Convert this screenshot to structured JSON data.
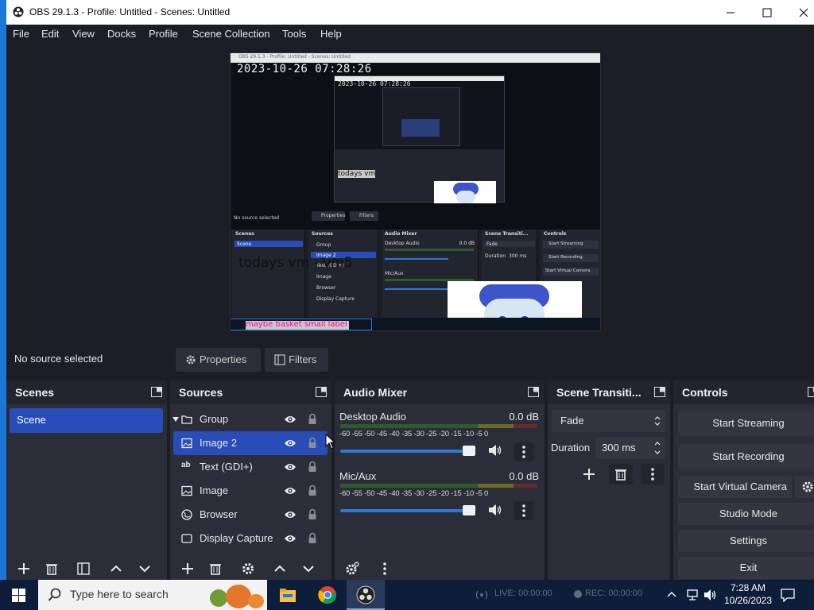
{
  "window": {
    "title": "OBS 29.1.3 - Profile: Untitled - Scenes: Untitled"
  },
  "menu": [
    "File",
    "Edit",
    "View",
    "Docks",
    "Profile",
    "Scene Collection",
    "Tools",
    "Help"
  ],
  "preview": {
    "window_title": "OBS 29.1.3 - Profile: Untitled - Scenes: Untitled",
    "timestamp": "2023-10-26 07:28:26",
    "inner_timestamp": "2023-10-26 07:28:26",
    "no_source_text": "No source selected",
    "overlay_text": "todays vm - vm5",
    "small_overlay_text": "todays vm",
    "scenes_title": "Scenes",
    "scene_item": "Scene",
    "sources_title": "Sources",
    "sources": [
      "Group",
      "Image 2",
      "Text (GDI+)",
      "Image",
      "Browser",
      "Display Capture"
    ],
    "mixer_title": "Audio Mixer",
    "mixer_ch1": "Desktop Audio",
    "mixer_ch2": "Mic/Aux",
    "mixer_db": "0.0 dB",
    "trans_title": "Scene Transiti...",
    "trans_value": "Fade",
    "duration_label": "Duration",
    "duration_value": "300 ms",
    "controls_title": "Controls",
    "controls": [
      "Start Streaming",
      "Start Recording",
      "Start Virtual Camera"
    ],
    "props_btn": "Properties",
    "filters_btn": "Filters",
    "ticker_text": "maybe basket small label",
    "ticker_bg": "#ff00aa"
  },
  "props_bar": {
    "no_source": "No source selected",
    "properties": "Properties",
    "filters": "Filters"
  },
  "scenes": {
    "title": "Scenes",
    "items": [
      "Scene"
    ]
  },
  "sources": {
    "title": "Sources",
    "items": [
      {
        "label": "Group",
        "icon": "folder-icon",
        "selected": false
      },
      {
        "label": "Image 2",
        "icon": "image-icon",
        "selected": true
      },
      {
        "label": "Text (GDI+)",
        "icon": "text-icon",
        "selected": false
      },
      {
        "label": "Image",
        "icon": "image-icon",
        "selected": false
      },
      {
        "label": "Browser",
        "icon": "globe-icon",
        "selected": false
      },
      {
        "label": "Display Capture",
        "icon": "monitor-icon",
        "selected": false
      }
    ]
  },
  "mixer": {
    "title": "Audio Mixer",
    "scale": [
      "-60",
      "-55",
      "-50",
      "-45",
      "-40",
      "-35",
      "-30",
      "-25",
      "-20",
      "-15",
      "-10",
      "-5",
      "0"
    ],
    "channels": [
      {
        "name": "Desktop Audio",
        "db": "0.0 dB",
        "volume": 1.0
      },
      {
        "name": "Mic/Aux",
        "db": "0.0 dB",
        "volume": 1.0
      }
    ]
  },
  "transitions": {
    "title": "Scene Transiti...",
    "selected": "Fade",
    "duration_label": "Duration",
    "duration": "300 ms"
  },
  "controls": {
    "title": "Controls",
    "streaming": "Start Streaming",
    "recording": "Start Recording",
    "virtual_camera": "Start Virtual Camera",
    "studio_mode": "Studio Mode",
    "settings": "Settings",
    "exit": "Exit"
  },
  "taskbar": {
    "search_placeholder": "Type here to search",
    "live": "LIVE: 00:00:00",
    "rec": "REC: 00:00:00",
    "time": "7:28 AM",
    "date": "10/26/2023"
  },
  "colors": {
    "accent": "#284cb8",
    "panel": "#2b2e38",
    "background": "#1c1e26",
    "slider": "#2a7ad8"
  }
}
